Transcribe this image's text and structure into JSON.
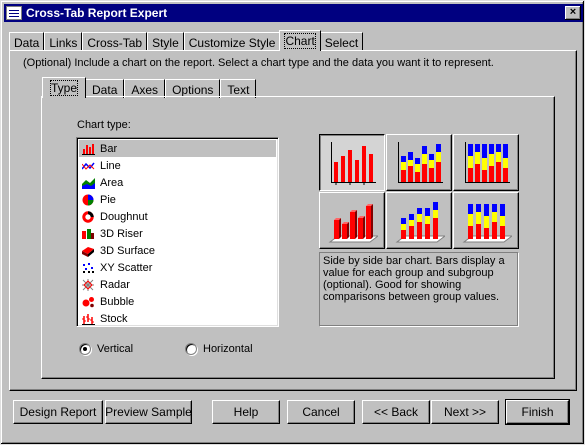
{
  "window": {
    "title": "Cross-Tab Report Expert",
    "close_glyph": "×"
  },
  "top_tabs": [
    {
      "label": "Data"
    },
    {
      "label": "Links"
    },
    {
      "label": "Cross-Tab"
    },
    {
      "label": "Style"
    },
    {
      "label": "Customize Style"
    },
    {
      "label": "Chart",
      "active": true
    },
    {
      "label": "Select"
    }
  ],
  "instruction": "(Optional) Include a chart on the report. Select a chart type and the data you want it to represent.",
  "inner_tabs": [
    {
      "label": "Type",
      "active": true
    },
    {
      "label": "Data"
    },
    {
      "label": "Axes"
    },
    {
      "label": "Options"
    },
    {
      "label": "Text"
    }
  ],
  "chart_type_label": "Chart type:",
  "chart_types": [
    {
      "label": "Bar",
      "icon": "bar-chart-icon",
      "selected": true
    },
    {
      "label": "Line",
      "icon": "line-chart-icon"
    },
    {
      "label": "Area",
      "icon": "area-chart-icon"
    },
    {
      "label": "Pie",
      "icon": "pie-chart-icon"
    },
    {
      "label": "Doughnut",
      "icon": "doughnut-chart-icon"
    },
    {
      "label": "3D Riser",
      "icon": "3d-riser-icon"
    },
    {
      "label": "3D Surface",
      "icon": "3d-surface-icon"
    },
    {
      "label": "XY Scatter",
      "icon": "xy-scatter-icon"
    },
    {
      "label": "Radar",
      "icon": "radar-chart-icon"
    },
    {
      "label": "Bubble",
      "icon": "bubble-chart-icon"
    },
    {
      "label": "Stock",
      "icon": "stock-chart-icon"
    }
  ],
  "orientation": {
    "vertical": {
      "label": "Vertical",
      "checked": true
    },
    "horizontal": {
      "label": "Horizontal",
      "checked": false
    }
  },
  "subtypes": [
    {
      "name": "side-by-side-bar",
      "selected": true
    },
    {
      "name": "stacked-bar"
    },
    {
      "name": "percent-bar"
    },
    {
      "name": "3d-side-by-side-bar"
    },
    {
      "name": "3d-stacked-bar"
    },
    {
      "name": "3d-percent-bar"
    }
  ],
  "description": "Side by side bar chart. Bars display a value for each group and subgroup (optional). Good for showing comparisons between group values.",
  "buttons": {
    "design_report": "Design Report",
    "preview_sample": "Preview Sample",
    "help": "Help",
    "cancel": "Cancel",
    "back": "<< Back",
    "next": "Next >>",
    "finish": "Finish"
  },
  "colors": {
    "title_bar": "#000080",
    "face": "#c0c0c0",
    "bar_red": "#ff0000",
    "bar_yellow": "#ffff00",
    "bar_blue": "#0000ff"
  }
}
